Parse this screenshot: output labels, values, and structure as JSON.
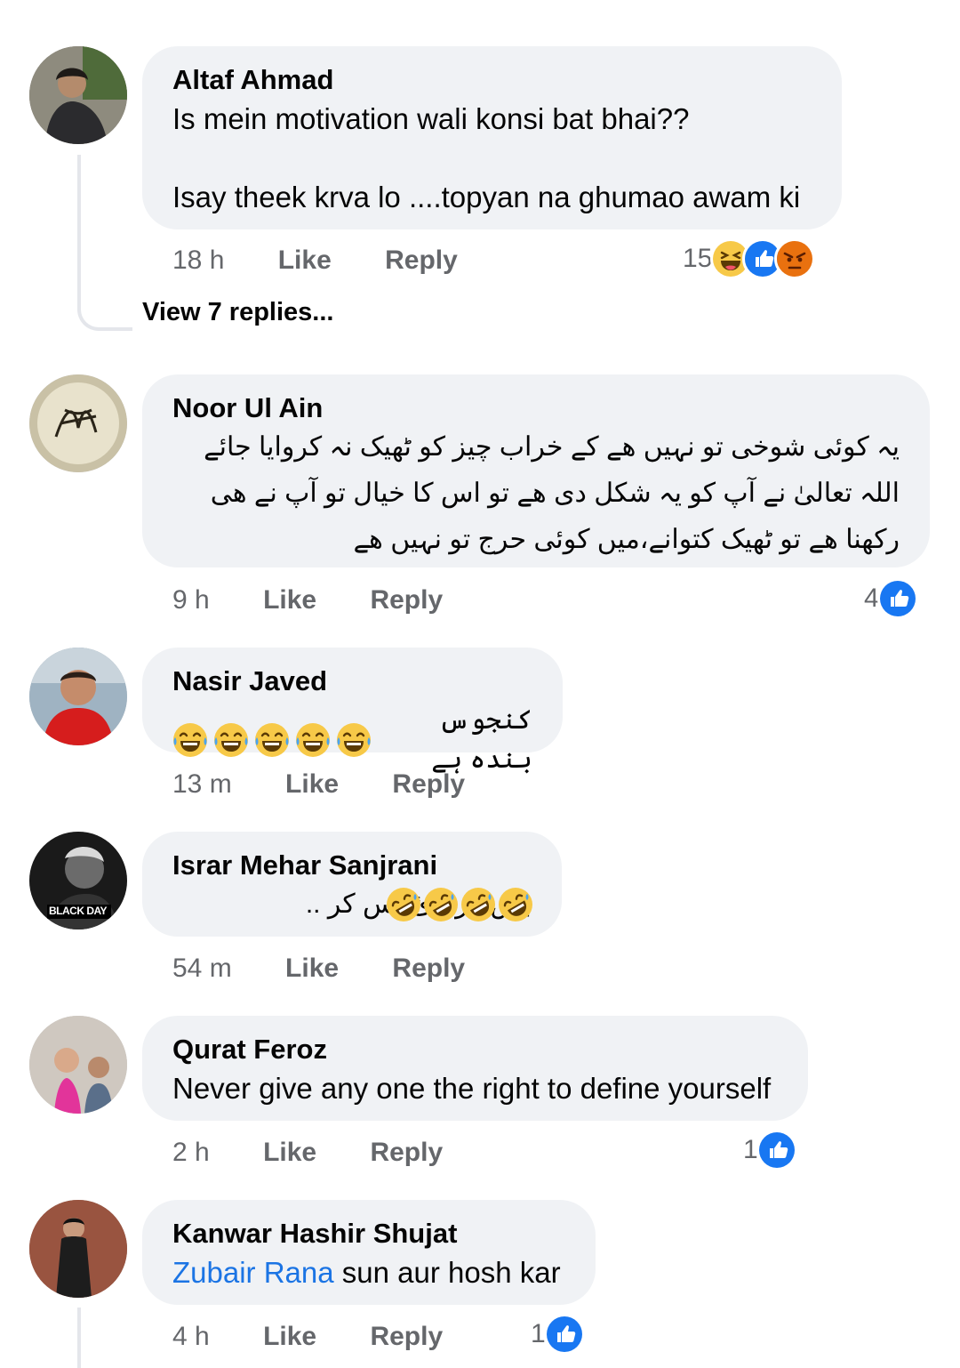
{
  "comments": [
    {
      "author": "Altaf Ahmad",
      "text_line1": "Is mein motivation wali konsi bat bhai??",
      "text_line2": "Isay theek krva lo ....topyan na ghumao awam ki",
      "time": "18 h",
      "like": "Like",
      "reply": "Reply",
      "reaction_count": "15",
      "reactions": [
        "haha-icon",
        "like-icon",
        "angry-icon"
      ],
      "view_replies": "View 7 replies..."
    },
    {
      "author": "Noor Ul Ain",
      "text_line1": "یہ کوئی شوخی تو نہیں ھے کے خراب چیز کو ٹھیک نہ کروایا جائے",
      "text_line2": "اللہ تعالیٰ نے آپ کو یہ شکل دی ھے تو اس کا خیال تو آپ نے ھی",
      "text_line3": "رکھنا ھے تو ٹھیک کتوانے،میں کوئی حرج تو نہیں ھے",
      "time": "9 h",
      "like": "Like",
      "reply": "Reply",
      "reaction_count": "4",
      "reactions": [
        "like-icon"
      ]
    },
    {
      "author": "Nasir Javed",
      "text": "کنجوس بندہ ہے",
      "emojis": [
        "joy-emoji",
        "joy-emoji",
        "joy-emoji",
        "joy-emoji",
        "joy-emoji"
      ],
      "time": "13 m",
      "like": "Like",
      "reply": "Reply"
    },
    {
      "author": "Israr Mehar Sanjrani",
      "text": "بس کر بائ بس کر ..",
      "emojis": [
        "rofl-emoji",
        "rofl-emoji",
        "rofl-emoji",
        "rofl-emoji"
      ],
      "avatar_caption": "BLACK DAY",
      "time": "54 m",
      "like": "Like",
      "reply": "Reply"
    },
    {
      "author": "Qurat Feroz",
      "text": "Never give any one the right to define yourself",
      "time": "2 h",
      "like": "Like",
      "reply": "Reply",
      "reaction_count": "1",
      "reactions": [
        "like-icon"
      ]
    },
    {
      "author": "Kanwar Hashir Shujat",
      "mention": "Zubair Rana",
      "text": " sun aur hosh kar",
      "time": "4 h",
      "like": "Like",
      "reply": "Reply",
      "reaction_count": "1",
      "reactions": [
        "like-icon"
      ]
    }
  ],
  "colors": {
    "bubble": "#f0f2f5",
    "like_blue": "#1877f2",
    "mention": "#1b74e4",
    "meta": "#65676b"
  }
}
